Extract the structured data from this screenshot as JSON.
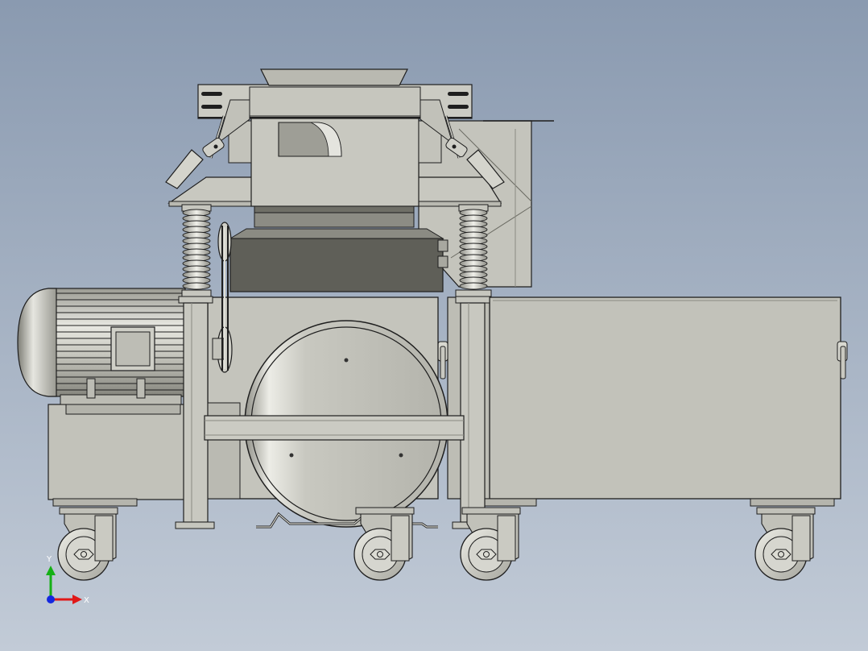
{
  "viewport": {
    "background_top": "#8a9ab0",
    "background_bottom": "#c2cbd7"
  },
  "colors": {
    "body_fill": "#c1c1b9",
    "body_shade": "#a7a79e",
    "dark_panel": "#5f5f58",
    "outline": "#1e1e1e",
    "wheel_fill": "#d6d6cf",
    "axis_x": "#e01818",
    "axis_y": "#15b015",
    "axis_z": "#1428e0"
  },
  "triad": {
    "x_label": "X",
    "y_label": "Y"
  }
}
